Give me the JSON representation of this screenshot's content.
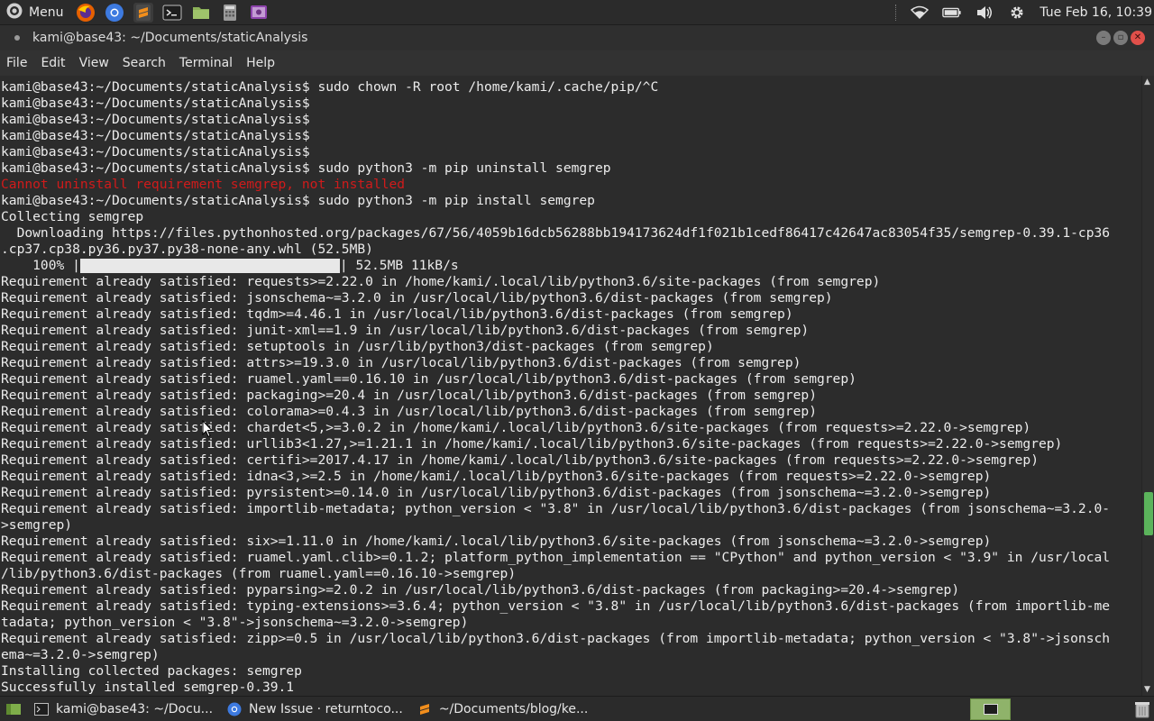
{
  "top_panel": {
    "menu_label": "Menu",
    "clock": "Tue Feb 16, 10:39"
  },
  "window": {
    "title": "kami@base43: ~/Documents/staticAnalysis"
  },
  "menubar": {
    "items": [
      "File",
      "Edit",
      "View",
      "Search",
      "Terminal",
      "Help"
    ]
  },
  "terminal": {
    "lines": [
      {
        "text": "kami@base43:~/Documents/staticAnalysis$ sudo chown -R root /home/kami/.cache/pip/^C",
        "type": "normal"
      },
      {
        "text": "kami@base43:~/Documents/staticAnalysis$",
        "type": "normal"
      },
      {
        "text": "kami@base43:~/Documents/staticAnalysis$",
        "type": "normal"
      },
      {
        "text": "kami@base43:~/Documents/staticAnalysis$",
        "type": "normal"
      },
      {
        "text": "kami@base43:~/Documents/staticAnalysis$",
        "type": "normal"
      },
      {
        "text": "kami@base43:~/Documents/staticAnalysis$ sudo python3 -m pip uninstall semgrep",
        "type": "normal"
      },
      {
        "text": "Cannot uninstall requirement semgrep, not installed",
        "type": "error"
      },
      {
        "text": "kami@base43:~/Documents/staticAnalysis$ sudo python3 -m pip install semgrep",
        "type": "normal"
      },
      {
        "text": "Collecting semgrep",
        "type": "normal"
      },
      {
        "text": "  Downloading https://files.pythonhosted.org/packages/67/56/4059b16dcb56288bb194173624df1f021b1cedf86417c42647ac83054f35/semgrep-0.39.1-cp36",
        "type": "normal"
      },
      {
        "text": ".cp37.cp38.py36.py37.py38-none-any.whl (52.5MB)",
        "type": "normal"
      },
      {
        "text": "",
        "type": "progress"
      },
      {
        "text": "Requirement already satisfied: requests>=2.22.0 in /home/kami/.local/lib/python3.6/site-packages (from semgrep)",
        "type": "normal"
      },
      {
        "text": "Requirement already satisfied: jsonschema~=3.2.0 in /usr/local/lib/python3.6/dist-packages (from semgrep)",
        "type": "normal"
      },
      {
        "text": "Requirement already satisfied: tqdm>=4.46.1 in /usr/local/lib/python3.6/dist-packages (from semgrep)",
        "type": "normal"
      },
      {
        "text": "Requirement already satisfied: junit-xml==1.9 in /usr/local/lib/python3.6/dist-packages (from semgrep)",
        "type": "normal"
      },
      {
        "text": "Requirement already satisfied: setuptools in /usr/lib/python3/dist-packages (from semgrep)",
        "type": "normal"
      },
      {
        "text": "Requirement already satisfied: attrs>=19.3.0 in /usr/local/lib/python3.6/dist-packages (from semgrep)",
        "type": "normal"
      },
      {
        "text": "Requirement already satisfied: ruamel.yaml==0.16.10 in /usr/local/lib/python3.6/dist-packages (from semgrep)",
        "type": "normal"
      },
      {
        "text": "Requirement already satisfied: packaging>=20.4 in /usr/local/lib/python3.6/dist-packages (from semgrep)",
        "type": "normal"
      },
      {
        "text": "Requirement already satisfied: colorama>=0.4.3 in /usr/local/lib/python3.6/dist-packages (from semgrep)",
        "type": "normal"
      },
      {
        "text": "Requirement already satisfied: chardet<5,>=3.0.2 in /home/kami/.local/lib/python3.6/site-packages (from requests>=2.22.0->semgrep)",
        "type": "normal"
      },
      {
        "text": "Requirement already satisfied: urllib3<1.27,>=1.21.1 in /home/kami/.local/lib/python3.6/site-packages (from requests>=2.22.0->semgrep)",
        "type": "normal"
      },
      {
        "text": "Requirement already satisfied: certifi>=2017.4.17 in /home/kami/.local/lib/python3.6/site-packages (from requests>=2.22.0->semgrep)",
        "type": "normal"
      },
      {
        "text": "Requirement already satisfied: idna<3,>=2.5 in /home/kami/.local/lib/python3.6/site-packages (from requests>=2.22.0->semgrep)",
        "type": "normal"
      },
      {
        "text": "Requirement already satisfied: pyrsistent>=0.14.0 in /usr/local/lib/python3.6/dist-packages (from jsonschema~=3.2.0->semgrep)",
        "type": "normal"
      },
      {
        "text": "Requirement already satisfied: importlib-metadata; python_version < \"3.8\" in /usr/local/lib/python3.6/dist-packages (from jsonschema~=3.2.0-",
        "type": "normal"
      },
      {
        "text": ">semgrep)",
        "type": "normal"
      },
      {
        "text": "Requirement already satisfied: six>=1.11.0 in /home/kami/.local/lib/python3.6/site-packages (from jsonschema~=3.2.0->semgrep)",
        "type": "normal"
      },
      {
        "text": "Requirement already satisfied: ruamel.yaml.clib>=0.1.2; platform_python_implementation == \"CPython\" and python_version < \"3.9\" in /usr/local",
        "type": "normal"
      },
      {
        "text": "/lib/python3.6/dist-packages (from ruamel.yaml==0.16.10->semgrep)",
        "type": "normal"
      },
      {
        "text": "Requirement already satisfied: pyparsing>=2.0.2 in /usr/local/lib/python3.6/dist-packages (from packaging>=20.4->semgrep)",
        "type": "normal"
      },
      {
        "text": "Requirement already satisfied: typing-extensions>=3.6.4; python_version < \"3.8\" in /usr/local/lib/python3.6/dist-packages (from importlib-me",
        "type": "normal"
      },
      {
        "text": "tadata; python_version < \"3.8\"->jsonschema~=3.2.0->semgrep)",
        "type": "normal"
      },
      {
        "text": "Requirement already satisfied: zipp>=0.5 in /usr/local/lib/python3.6/dist-packages (from importlib-metadata; python_version < \"3.8\"->jsonsch",
        "type": "normal"
      },
      {
        "text": "ema~=3.2.0->semgrep)",
        "type": "normal"
      },
      {
        "text": "Installing collected packages: semgrep",
        "type": "normal"
      },
      {
        "text": "Successfully installed semgrep-0.39.1",
        "type": "normal"
      }
    ],
    "progress": {
      "percent_label": "    100% |",
      "tail": "| 52.5MB 11kB/s",
      "fraction": 1.0
    }
  },
  "taskbar": {
    "items": [
      {
        "label": "kami@base43: ~/Docu...",
        "icon": "terminal-icon"
      },
      {
        "label": "New Issue · returntoco...",
        "icon": "chrome-icon"
      },
      {
        "label": "~/Documents/blog/ke...",
        "icon": "sublime-icon"
      }
    ]
  },
  "colors": {
    "error": "#d01b1b",
    "scroll_thumb": "#5bb35b"
  }
}
